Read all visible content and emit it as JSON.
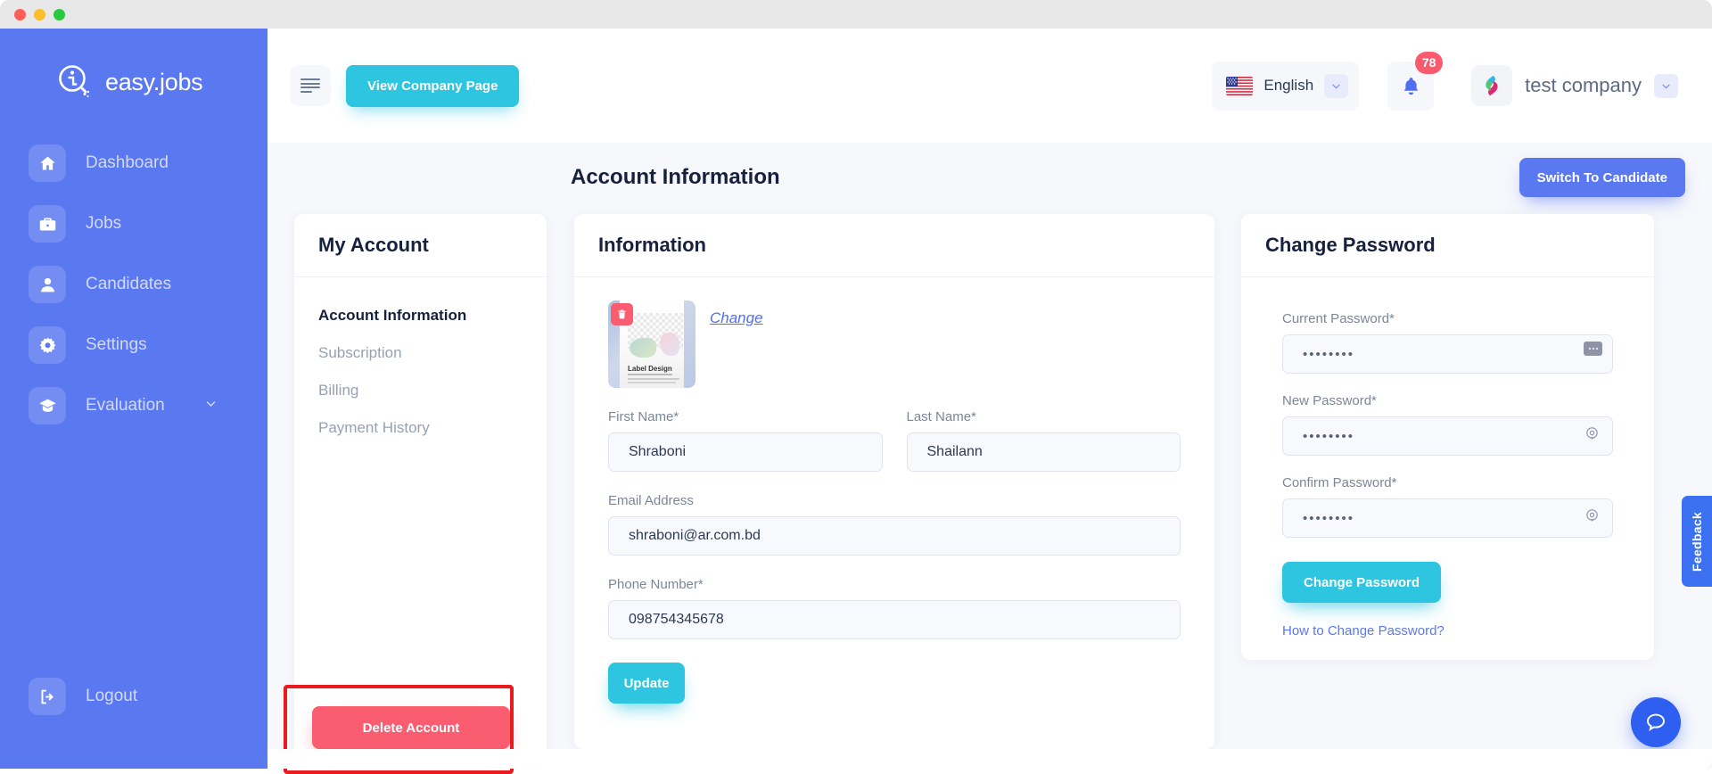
{
  "window": {
    "title": "easy.jobs"
  },
  "brand": {
    "name": "easy.jobs"
  },
  "sidebar": {
    "items": [
      {
        "label": "Dashboard",
        "icon": "home-icon",
        "has_chevron": false
      },
      {
        "label": "Jobs",
        "icon": "briefcase-icon",
        "has_chevron": false
      },
      {
        "label": "Candidates",
        "icon": "user-icon",
        "has_chevron": false
      },
      {
        "label": "Settings",
        "icon": "gear-icon",
        "has_chevron": false
      },
      {
        "label": "Evaluation",
        "icon": "graduation-cap-icon",
        "has_chevron": true
      }
    ],
    "logout": {
      "label": "Logout",
      "icon": "logout-icon"
    }
  },
  "topbar": {
    "menu_toggle_icon": "hamburger-icon",
    "view_company_label": "View Company Page",
    "language": {
      "value": "English",
      "flag": "us-flag-icon",
      "chevron": "chevron-down-icon"
    },
    "notifications": {
      "count": "78",
      "icon": "bell-icon"
    },
    "company": {
      "name": "test company",
      "logo": "company-logo-icon",
      "chevron": "chevron-down-icon"
    }
  },
  "page": {
    "title": "Account Information",
    "switch_button": "Switch To Candidate"
  },
  "account_card": {
    "title": "My Account",
    "menu": [
      {
        "label": "Account Information",
        "active": true
      },
      {
        "label": "Subscription",
        "active": false
      },
      {
        "label": "Billing",
        "active": false
      },
      {
        "label": "Payment History",
        "active": false
      }
    ],
    "delete_button": "Delete Account"
  },
  "information": {
    "title": "Information",
    "avatar": {
      "alt": "Label Design",
      "caption": "Label Design",
      "delete_icon": "trash-icon"
    },
    "change_link": "Change",
    "fields": {
      "first_name": {
        "label": "First Name*",
        "value": "Shraboni",
        "placeholder": "First Name"
      },
      "last_name": {
        "label": "Last Name*",
        "value": "Shailann",
        "placeholder": "Last Name"
      },
      "email": {
        "label": "Email Address",
        "value": "shraboni@ar.com.bd",
        "placeholder": "Email Address"
      },
      "phone": {
        "label": "Phone Number*",
        "value": "098754345678",
        "placeholder": "Phone Number"
      }
    },
    "update_button": "Update"
  },
  "change_password": {
    "title": "Change Password",
    "current": {
      "label": "Current Password*",
      "value": "••••••••",
      "mask": "********",
      "toggle_icon": "keyboard-icon"
    },
    "new": {
      "label": "New Password*",
      "value": "••••••••",
      "mask": "********",
      "toggle_icon": "eye-icon"
    },
    "confirm": {
      "label": "Confirm Password*",
      "value": "••••••••",
      "mask": "********",
      "toggle_icon": "eye-icon"
    },
    "submit_button": "Change Password",
    "help_link": "How to Change Password?"
  },
  "feedback_tab": {
    "label": "Feedback"
  },
  "chat": {
    "icon": "chat-bubble-icon"
  },
  "colors": {
    "sidebar": "#5a78f0",
    "primary_cyan": "#2ec5e0",
    "primary_blue": "#5a78f0",
    "danger": "#fa5d70",
    "highlight_outline": "#e81c1c",
    "badge": "#fa5a6e",
    "page_bg": "#f7f8fc"
  }
}
